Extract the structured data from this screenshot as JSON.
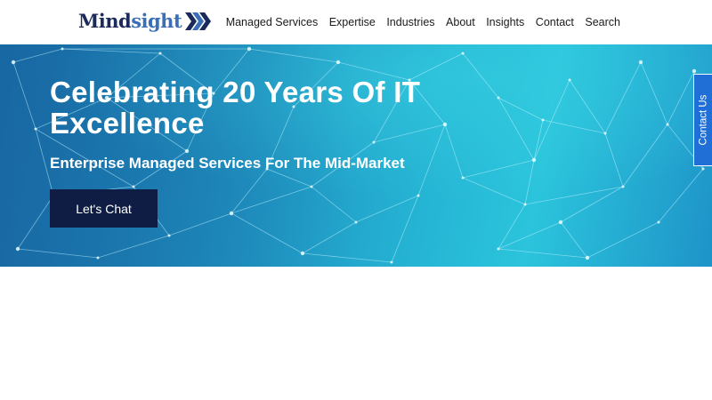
{
  "brand": {
    "logo_part1": "Mind",
    "logo_part2": "sight"
  },
  "nav": {
    "items": [
      {
        "label": "Managed Services"
      },
      {
        "label": "Expertise"
      },
      {
        "label": "Industries"
      },
      {
        "label": "About"
      },
      {
        "label": "Insights"
      },
      {
        "label": "Contact"
      },
      {
        "label": "Search"
      }
    ]
  },
  "hero": {
    "title": "Celebrating 20 Years Of IT Excellence",
    "subtitle": "Enterprise Managed Services For The Mid-Market",
    "cta_label": "Let's Chat"
  },
  "contact_tab": {
    "label": "Contact Us"
  },
  "colors": {
    "brand_navy": "#1b2a5a",
    "brand_blue": "#3a6fb7",
    "cta_background": "#0f1d45",
    "contact_tab": "#1f6fd6",
    "hero_cyan": "#2bc4dc",
    "hero_blue": "#1a6da8"
  },
  "icons": {
    "logo_mark": "chevron-arrows-icon",
    "hero_background": "network-mesh-graphic"
  }
}
